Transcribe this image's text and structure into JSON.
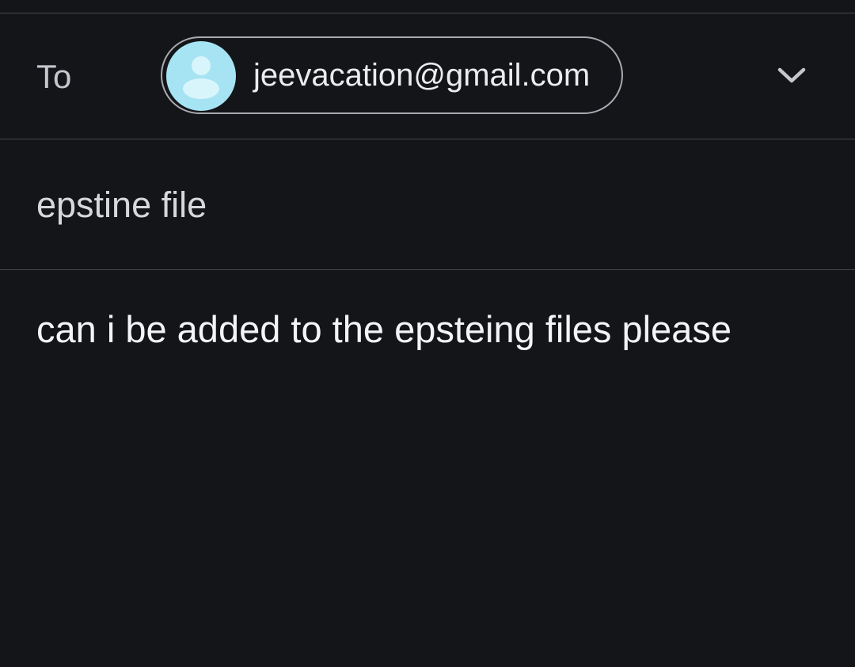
{
  "compose": {
    "to_label": "To",
    "recipient": {
      "email": "jeevacation@gmail.com",
      "avatar_icon": "person-icon",
      "avatar_color": "#a6e3f3"
    },
    "expand_icon": "chevron-down-icon",
    "subject": "epstine file",
    "body": "can i be added to the epsteing files please"
  },
  "theme": {
    "background": "#141519",
    "divider": "#47484d"
  }
}
